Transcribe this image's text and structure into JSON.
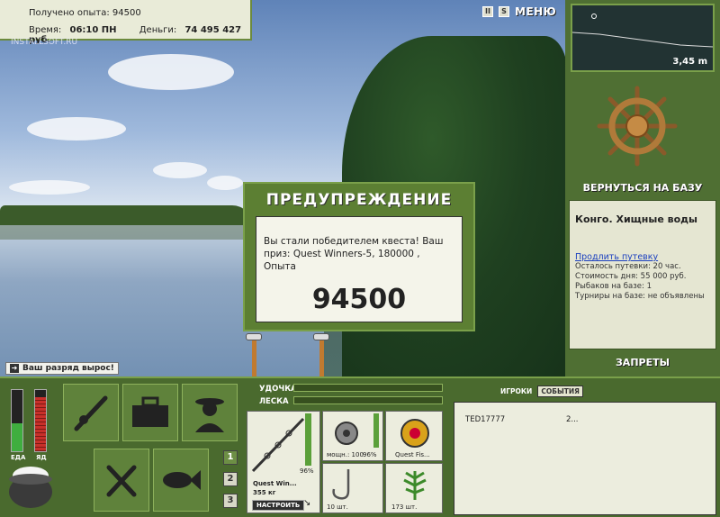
{
  "hud": {
    "exp_label": "Получено опыта:",
    "exp_value": "94500",
    "time_label": "Время:",
    "time_value": "06:10 ПН",
    "money_label": "Деньги:",
    "money_value": "74 495 427 руб.",
    "watermark": "INSTALLSOFT.RU"
  },
  "top_buttons": {
    "pause": "II",
    "sound": "S",
    "menu": "МЕНЮ"
  },
  "rank_message": "Ваш разряд вырос!",
  "dialog": {
    "title": "ПРЕДУПРЕЖДЕНИЕ",
    "message": "Вы стали победителем квеста! Ваш приз: Quest Winners-5, 180000 , Опыта",
    "big_value": "94500"
  },
  "depth": {
    "value": "3,45 m"
  },
  "right_panel": {
    "back_to_base": "ВЕРНУТЬСЯ НА БАЗУ",
    "location": "Конго. Хищные воды",
    "extend_link": "Продлить путевку",
    "lines": [
      "Осталось путевки: 20 час.",
      "Стоимость дня: 55 000 руб.",
      "Рыбаков на базе: 1",
      "Турниры на базе: не объявлены"
    ],
    "bans": "ЗАПРЕТЫ"
  },
  "meters": {
    "food_label": "ЕДА",
    "poison_label": "ЯД",
    "food_level": 0.45,
    "poison_level": 0.88
  },
  "pages": [
    "1",
    "2",
    "3"
  ],
  "tackle": {
    "rod_label": "УДОЧКА",
    "line_label": "ЛЕСКА",
    "rod_name": "Quest Win...",
    "rod_weight": "355 кг",
    "rod_percent": "96%",
    "reel_caption": "мощн.: 100",
    "reel_percent": "96%",
    "line_caption": "Quest Fis...",
    "hook_caption": "10 шт.",
    "bait_caption": "173 шт.",
    "setup_button": "НАСТРОИТЬ"
  },
  "players": {
    "tab_players": "ИГРОКИ",
    "tab_events": "СОБЫТИЯ",
    "rows": [
      {
        "name": "TED17777",
        "value": "2..."
      }
    ]
  },
  "colors": {
    "panel_green": "#4a6a2e",
    "accent_green": "#7aa04a",
    "food_green": "#3fae3f",
    "poison_red": "#c8302a"
  }
}
